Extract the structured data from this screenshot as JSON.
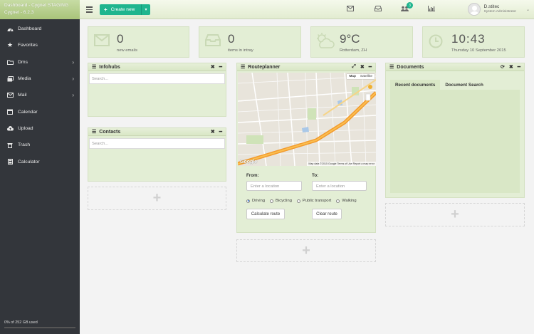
{
  "app": {
    "title": "Dashboard - Cygnet STAGING",
    "version": "Cygnet - 6.2.3"
  },
  "sidebar": {
    "items": [
      {
        "label": "Dashboard",
        "icon": "dashboard-icon"
      },
      {
        "label": "Favorites",
        "icon": "star-icon"
      },
      {
        "label": "Dms",
        "icon": "folder-icon"
      },
      {
        "label": "Media",
        "icon": "media-icon"
      },
      {
        "label": "Mail",
        "icon": "envelope-icon"
      },
      {
        "label": "Calendar",
        "icon": "calendar-icon"
      },
      {
        "label": "Upload",
        "icon": "upload-icon"
      },
      {
        "label": "Trash",
        "icon": "trash-icon"
      },
      {
        "label": "Calculator",
        "icon": "calculator-icon"
      }
    ],
    "storage": {
      "label": "0% of 252 GB used",
      "used_fraction": 0.0
    }
  },
  "topbar": {
    "create_label": "Create new",
    "badge_count": "3",
    "user": {
      "name": "D.stitec",
      "role": "System Administrator"
    }
  },
  "stats": {
    "emails": {
      "value": "0",
      "label": "new emails"
    },
    "intray": {
      "value": "0",
      "label": "items in intray"
    },
    "weather": {
      "value": "9°C",
      "label": "Rotterdam, ZH"
    },
    "time": {
      "value": "10:43",
      "label": "Thursday 10 September 2015"
    }
  },
  "infohubs": {
    "title": "Infohubs",
    "search_placeholder": "Search..."
  },
  "contacts": {
    "title": "Contacts",
    "search_placeholder": "Search..."
  },
  "routeplanner": {
    "title": "Routeplanner",
    "map_toggle": [
      "Map",
      "Satellite"
    ],
    "map_footer": "Map data ©2015 Google   Terms of Use   Report a map error",
    "map_logo": "Google",
    "from_label": "From:",
    "to_label": "To:",
    "location_placeholder": "Enter a location",
    "modes": [
      "Driving",
      "Bicycling",
      "Public transport",
      "Walking"
    ],
    "selected_mode": "Driving",
    "calculate_label": "Calculate route",
    "clear_label": "Clear route"
  },
  "documents": {
    "title": "Documents",
    "tabs": [
      "Recent documents",
      "Document Search"
    ]
  }
}
